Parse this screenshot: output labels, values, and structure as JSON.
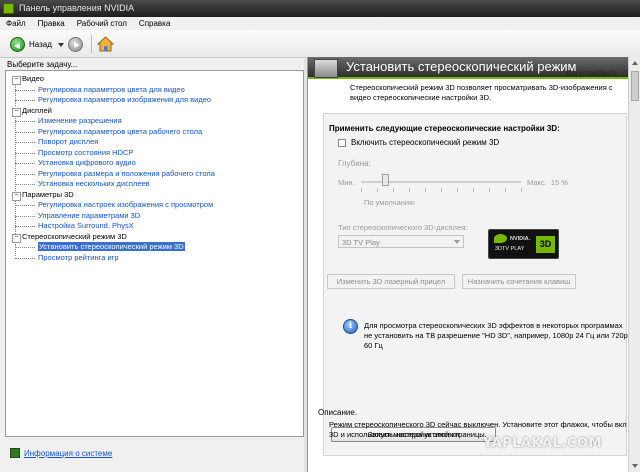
{
  "window": {
    "title": "Панель управления NVIDIA"
  },
  "menu": [
    "Файл",
    "Правка",
    "Рабочий стол",
    "Справка"
  ],
  "toolbar": {
    "back_label": "Назад",
    "icons": [
      "back-icon",
      "forward-icon",
      "home-icon"
    ]
  },
  "task_header": "Выберите задачу...",
  "tree": [
    {
      "type": "cat",
      "label": "Видео"
    },
    {
      "type": "sub",
      "label": "Регулировка параметров цвета для видео"
    },
    {
      "type": "sub",
      "label": "Регулировка параметров изображения для видео"
    },
    {
      "type": "cat",
      "label": "Дисплей"
    },
    {
      "type": "sub",
      "label": "Изменение разрешения"
    },
    {
      "type": "sub",
      "label": "Регулировка параметров цвета рабочего стола"
    },
    {
      "type": "sub",
      "label": "Поворот дисплея"
    },
    {
      "type": "sub",
      "label": "Просмотр состояния HDCP"
    },
    {
      "type": "sub",
      "label": "Установка цифрового аудио"
    },
    {
      "type": "sub",
      "label": "Регулировка размера и положения рабочего стола"
    },
    {
      "type": "sub",
      "label": "Установка нескольких дисплеев"
    },
    {
      "type": "cat",
      "label": "Параметры 3D"
    },
    {
      "type": "sub",
      "label": "Регулировка настроек изображения с просмотром"
    },
    {
      "type": "sub",
      "label": "Управление параметрами 3D"
    },
    {
      "type": "sub",
      "label": "Настройка Surround, PhysX"
    },
    {
      "type": "cat",
      "label": "Стереоскопический режим 3D"
    },
    {
      "type": "sub",
      "label": "Установить стереоскопический режим 3D",
      "selected": true
    },
    {
      "type": "sub",
      "label": "Просмотр рейтинга игр"
    }
  ],
  "sysinfo_link": "Информация о системе",
  "page": {
    "title": "Установить стереоскопический режим",
    "restore": "Восстановить",
    "intro": "Стереоскопический режим 3D позволяет просматривать 3D-изображения с видео стереоскопические настройки 3D.",
    "panel_title": "Применить следующие стереоскопические настройки 3D:",
    "enable_checkbox": "Включить стереоскопический режим 3D",
    "enable_checked": false,
    "depth_label": "Глубина:",
    "min_label": "Мин.",
    "max_label": "Макс.",
    "depth_value": "15 %",
    "depth_level": 0.15,
    "default_label": "По умолчанию",
    "display_type_label": "Тип стереоскопического 3D-дисплея:",
    "display_type_value": "3D TV Play",
    "logo": {
      "brand": "NVIDIA.",
      "product": "3DTV PLAY",
      "badge": "3D"
    },
    "laser_button": "Изменить 3D лазерный прицел",
    "hotkeys_button": "Назначить сочетания клавиш",
    "info_text": "Для просмотра стереоскопических 3D эффектов в некоторых программах не установить на ТВ разрешение \"HD 3D\", например, 1080p 24 Гц или 720p 60 Гц",
    "wizard_button": "Запуск мастера установки",
    "description_label": "Описание.",
    "description_text": "Режим стереоскопического 3D сейчас выключен. Установите этот флажок, чтобы вкл 3D и использовать настройки этой страницы.",
    "watermark": "YAPLAKAL.COM"
  },
  "colors": {
    "nvidia_green": "#76b900",
    "link_blue": "#1155cc",
    "selection": "#3a6fd0"
  }
}
